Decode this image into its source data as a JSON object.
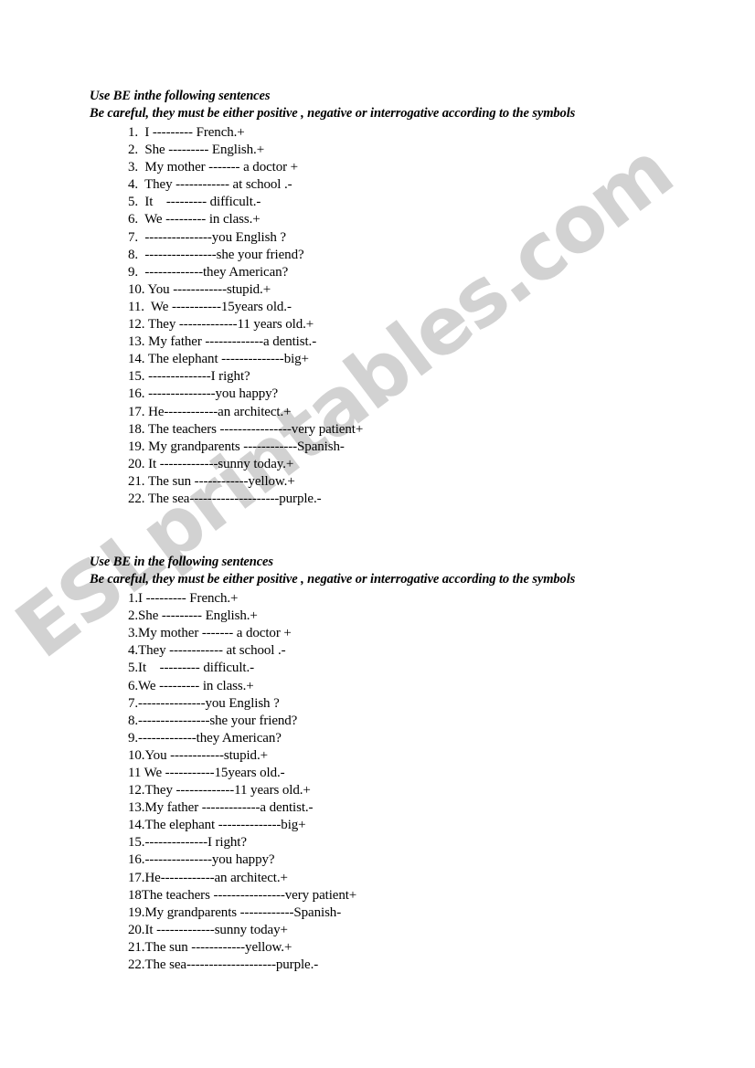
{
  "document": {
    "type": "worksheet",
    "watermark": "ESLprintables.com",
    "watermark_color": "#d2d2d2",
    "background_color": "#ffffff",
    "text_color": "#000000"
  },
  "sections": [
    {
      "heading_line_1": "Use BE inthe following sentences",
      "heading_line_2": "Be careful, they must be either positive , negative or interrogative according to the symbols",
      "items": [
        "1.  I --------- French.+",
        "2.  She --------- English.+",
        "3.  My mother ------- a doctor +",
        "4.  They ------------ at school .-",
        "5.  It    --------- difficult.-",
        "6.  We --------- in class.+",
        "7.  ---------------you English ?",
        "8.  ----------------she your friend?",
        "9.  -------------they American?",
        "10. You ------------stupid.+",
        "11.  We -----------15years old.-",
        "12. They -------------11 years old.+",
        "13. My father -------------a dentist.-",
        "14. The elephant --------------big+",
        "15. --------------I right?",
        "16. ---------------you happy?",
        "17. He------------an architect.+",
        "18. The teachers ----------------very patient+",
        "19. My grandparents ------------Spanish-",
        "20. It -------------sunny today.+",
        "21. The sun ------------yellow.+",
        "22. The sea--------------------purple.-"
      ]
    },
    {
      "heading_line_1": "Use BE in the following sentences",
      "heading_line_2": "Be careful, they must be either positive , negative or interrogative according to the symbols",
      "items": [
        "1.I --------- French.+",
        "2.She --------- English.+",
        "3.My mother ------- a doctor +",
        "4.They ------------ at school .-",
        "5.It    --------- difficult.-",
        "6.We --------- in class.+",
        "7.---------------you English ?",
        "8.----------------she your friend?",
        "9.-------------they American?",
        "10.You ------------stupid.+",
        "11 We -----------15years old.-",
        "12.They -------------11 years old.+",
        "13.My father -------------a dentist.-",
        "14.The elephant --------------big+",
        "15.--------------I right?",
        "16.---------------you happy?",
        "17.He------------an architect.+",
        "18The teachers ----------------very patient+",
        "19.My grandparents ------------Spanish-",
        "20.It -------------sunny today+",
        "21.The sun ------------yellow.+",
        "22.The sea--------------------purple.-"
      ]
    }
  ]
}
